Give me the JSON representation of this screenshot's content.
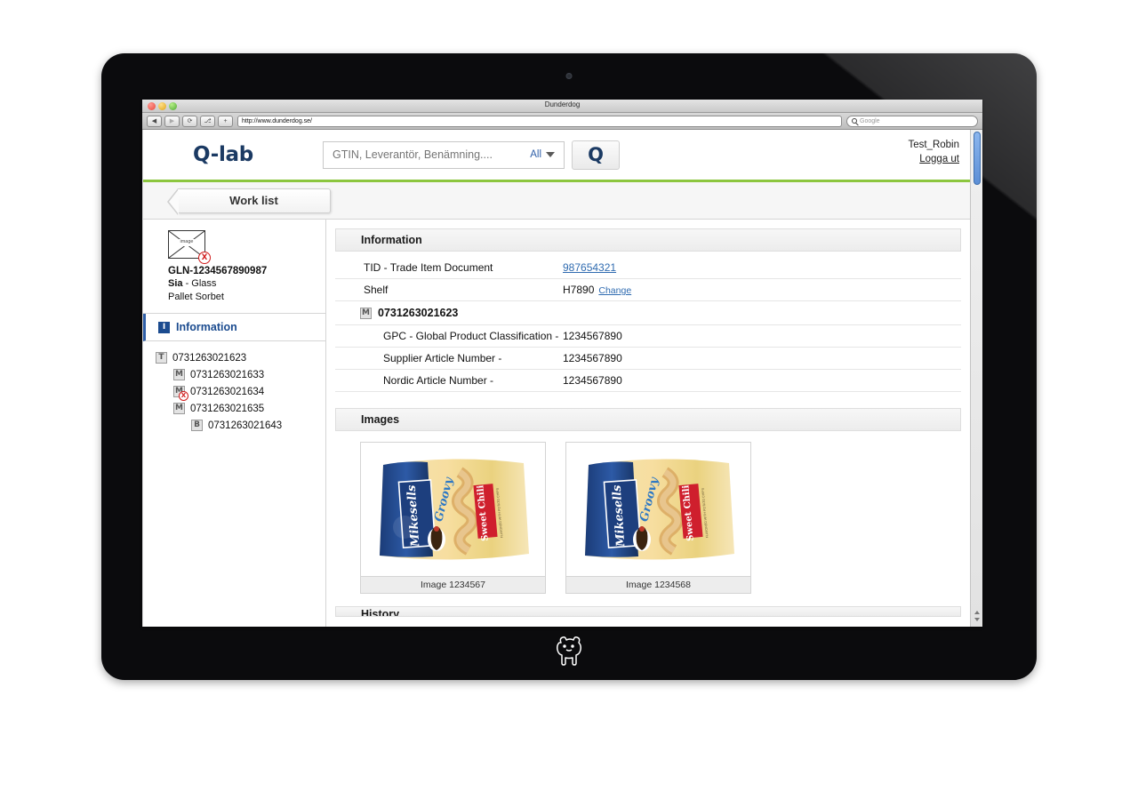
{
  "browser": {
    "window_title": "Dunderdog",
    "url": "http://www.dunderdog.se/",
    "search_placeholder": "Google",
    "back_glyph": "◀",
    "forward_glyph": "▶",
    "reload_glyph": "⟳",
    "share_glyph": "⎇",
    "add_glyph": "+"
  },
  "header": {
    "logo": "Q-lab",
    "search_placeholder": "GTIN, Leverantör, Benämning....",
    "search_scope": "All",
    "search_button": "Q",
    "user": "Test_Robin",
    "logout": "Logga ut",
    "accent_green": "#8cc63f",
    "brand_navy": "#1b3a63"
  },
  "tabs": {
    "worklist": "Work list"
  },
  "sidebar": {
    "thumbnail_caption": "image",
    "thumbnail_error": "X",
    "gln": "GLN-1234567890987",
    "supplier": "Sia",
    "supplier_sep": " - ",
    "category": "Glass",
    "product": "Pallet Sorbet",
    "info_tab": {
      "icon": "I",
      "label": "Information"
    },
    "tree": [
      {
        "icon": "T",
        "label": "0731263021623",
        "indent": 0,
        "error": false
      },
      {
        "icon": "M",
        "label": "0731263021633",
        "indent": 1,
        "error": false
      },
      {
        "icon": "M",
        "label": "0731263021634",
        "indent": 1,
        "error": true,
        "error_glyph": "X"
      },
      {
        "icon": "M",
        "label": "0731263021635",
        "indent": 1,
        "error": false
      },
      {
        "icon": "B",
        "label": "0731263021643",
        "indent": 2,
        "error": false
      }
    ]
  },
  "information": {
    "section_title": "Information",
    "rows": [
      {
        "key": "TID  - Trade Item Document",
        "value": "987654321",
        "type": "link"
      },
      {
        "key": "Shelf",
        "value": "H7890",
        "type": "value-with-action",
        "action": "Change"
      }
    ],
    "group": {
      "icon": "M",
      "label": "0731263021623"
    },
    "group_rows": [
      {
        "key": "GPC - Global Product Classification -",
        "value": "1234567890"
      },
      {
        "key": "Supplier Article Number -",
        "value": "1234567890"
      },
      {
        "key": "Nordic Article Number -",
        "value": "1234567890"
      }
    ]
  },
  "images": {
    "section_title": "Images",
    "items": [
      {
        "caption": "Image 1234567",
        "brand": "Mikesells",
        "style": "Groovy",
        "flavor": "Sweet Chili"
      },
      {
        "caption": "Image 1234568",
        "brand": "Mikesells",
        "style": "Groovy",
        "flavor": "Sweet Chili"
      }
    ]
  },
  "next_section": {
    "title": "History"
  }
}
